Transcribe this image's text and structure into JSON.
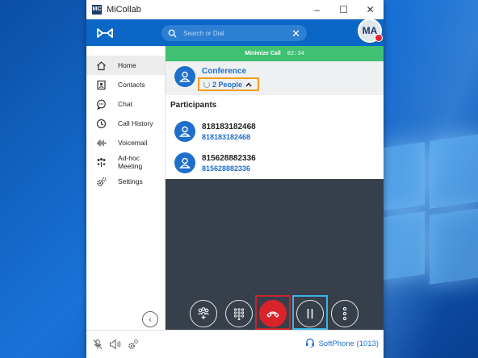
{
  "window": {
    "title": "MiCollab",
    "app_icon_text": "MC",
    "controls": {
      "minimize": "–",
      "maximize": "☐",
      "close": "✕"
    }
  },
  "header": {
    "search_placeholder": "Search or Dial",
    "search_clear": "✕",
    "avatar_initials": "MA",
    "brand_color": "#0b67c6",
    "presence_color": "#e0262b"
  },
  "sidebar": {
    "items": [
      {
        "label": "Home",
        "icon": "home-icon",
        "active": true
      },
      {
        "label": "Contacts",
        "icon": "contacts-icon",
        "active": false
      },
      {
        "label": "Chat",
        "icon": "chat-icon",
        "active": false
      },
      {
        "label": "Call History",
        "icon": "call-history-icon",
        "active": false
      },
      {
        "label": "Voicemail",
        "icon": "voicemail-icon",
        "active": false
      },
      {
        "label": "Ad-hoc Meeting",
        "icon": "meeting-icon",
        "active": false
      },
      {
        "label": "Settings",
        "icon": "settings-icon",
        "active": false
      }
    ],
    "collapse_glyph": "‹"
  },
  "call": {
    "minimize_label": "Minimize Call",
    "timer": "02:34",
    "conference_title": "Conference",
    "people_count_label": "2 People",
    "participants_heading": "Participants",
    "participants": [
      {
        "number": "818183182468",
        "sub": "818183182468"
      },
      {
        "number": "815628882336",
        "sub": "815628882336"
      }
    ],
    "controls": [
      "add-participant",
      "dialpad",
      "end-call",
      "hold",
      "more"
    ],
    "highlight_colors": {
      "people": "#f39c1f",
      "end_call": "#c8242b",
      "hold": "#3ab4e6"
    }
  },
  "statusbar": {
    "softphone_label": "SoftPhone (1013)"
  }
}
